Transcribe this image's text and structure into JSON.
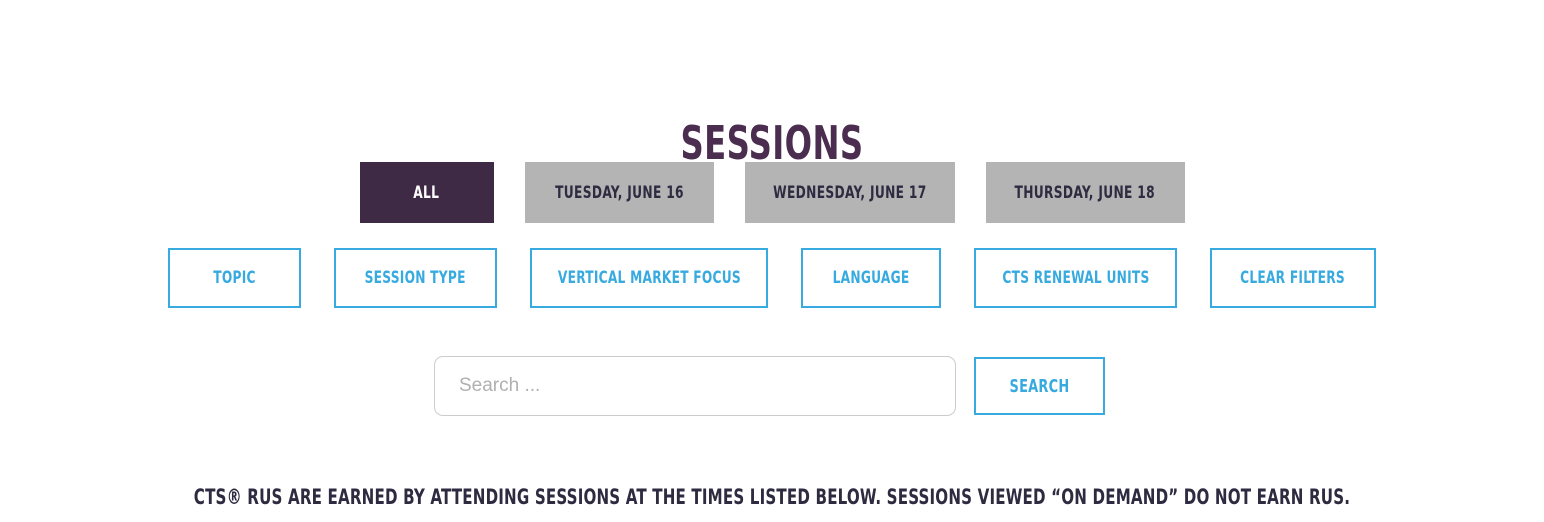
{
  "page": {
    "title": "SESSIONS",
    "background_color": "#ffffff"
  },
  "theme": {
    "title_purple": "#4b2d50",
    "active_tab_purple": "#3e2a45",
    "inactive_tab_gray": "#b4b4b4",
    "accent_blue": "#37aadf",
    "footer_text_color": "#2e2a40",
    "input_border_gray": "#cccccc",
    "placeholder_gray": "#b0b0b0"
  },
  "day_tabs": {
    "items": [
      {
        "label": "ALL",
        "active": true
      },
      {
        "label": "TUESDAY, JUNE 16",
        "active": false
      },
      {
        "label": "WEDNESDAY, JUNE 17",
        "active": false
      },
      {
        "label": "THURSDAY, JUNE 18",
        "active": false
      }
    ]
  },
  "filters": {
    "items": [
      {
        "label": "TOPIC"
      },
      {
        "label": "SESSION TYPE"
      },
      {
        "label": "VERTICAL MARKET FOCUS"
      },
      {
        "label": "LANGUAGE"
      },
      {
        "label": "CTS RENEWAL UNITS"
      },
      {
        "label": "CLEAR FILTERS"
      }
    ]
  },
  "search": {
    "value": "",
    "placeholder": "Search ...",
    "button_label": "SEARCH"
  },
  "footer": {
    "note": "CTS® RUS ARE EARNED BY ATTENDING SESSIONS AT THE TIMES LISTED BELOW. SESSIONS VIEWED “ON DEMAND” DO NOT EARN RUS."
  }
}
